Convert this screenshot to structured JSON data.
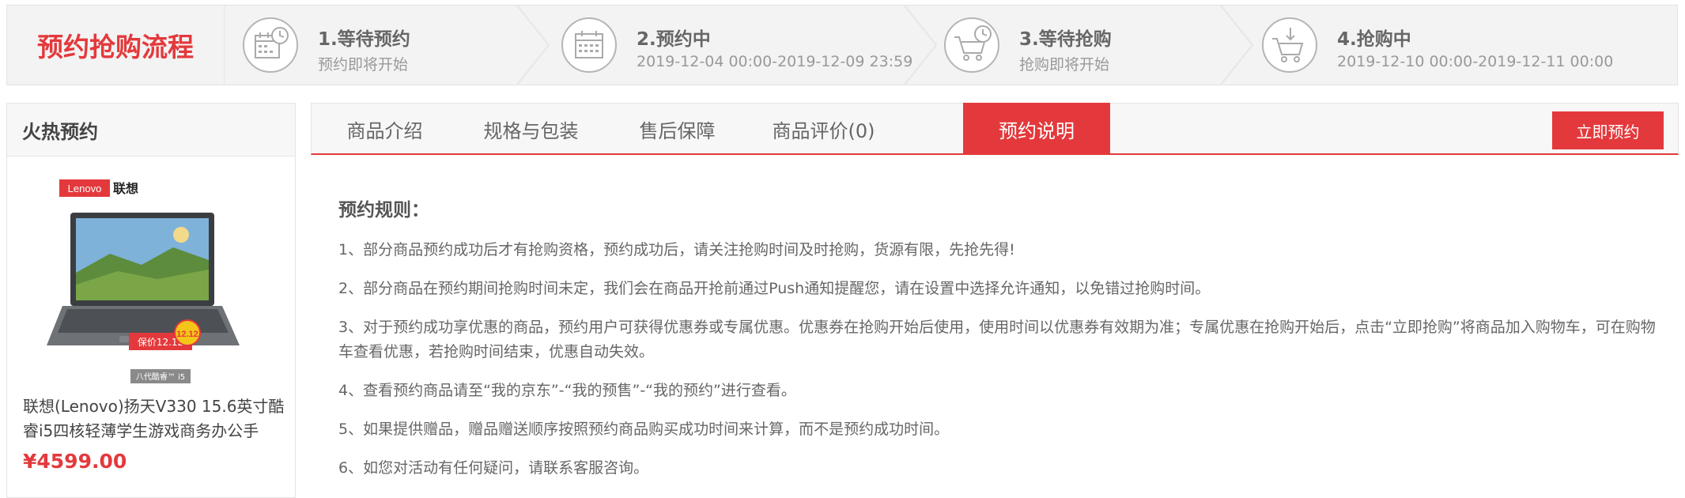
{
  "process": {
    "title": "预约抢购流程",
    "steps": [
      {
        "title": "1.等待预约",
        "sub": "预约即将开始",
        "icon": "calendar-clock-icon"
      },
      {
        "title": "2.预约中",
        "sub": "2019-12-04 00:00-2019-12-09 23:59",
        "icon": "calendar-icon"
      },
      {
        "title": "3.等待抢购",
        "sub": "抢购即将开始",
        "icon": "cart-clock-icon"
      },
      {
        "title": "4.抢购中",
        "sub": "2019-12-10 00:00-2019-12-11 00:00",
        "icon": "cart-download-icon"
      }
    ]
  },
  "sidebar": {
    "title": "火热预约",
    "product": {
      "brand_en": "Lenovo",
      "brand_cn": "联想",
      "promo": "保价12.12",
      "badge": "12.12",
      "cpu_tag": "八代酷睿™ i5",
      "name": "联想(Lenovo)扬天V330 15.6英寸酷睿i5四核轻薄学生游戏商务办公手",
      "price": "¥4599.00"
    }
  },
  "tabs": [
    "商品介绍",
    "规格与包装",
    "售后保障",
    "商品评价(0)",
    "预约说明"
  ],
  "active_tab": 4,
  "reserve_button": "立即预约",
  "rules": {
    "title": "预约规则：",
    "items": [
      "1、部分商品预约成功后才有抢购资格，预约成功后，请关注抢购时间及时抢购，货源有限，先抢先得!",
      "2、部分商品在预约期间抢购时间未定，我们会在商品开抢前通过Push通知提醒您，请在设置中选择允许通知，以免错过抢购时间。",
      "3、对于预约成功享优惠的商品，预约用户可获得优惠券或专属优惠。优惠券在抢购开始后使用，使用时间以优惠券有效期为准；专属优惠在抢购开始后，点击“立即抢购”将商品加入购物车，可在购物车查看优惠，若抢购时间结束，优惠自动失效。",
      "4、查看预约商品请至“我的京东”-“我的预售”-“我的预约”进行查看。",
      "5、如果提供赠品，赠品赠送顺序按照预约商品购买成功时间来计算，而不是预约成功时间。",
      "6、如您对活动有任何疑问，请联系客服咨询。"
    ]
  },
  "colors": {
    "accent": "#e4393c",
    "text": "#666666",
    "muted": "#999999"
  }
}
